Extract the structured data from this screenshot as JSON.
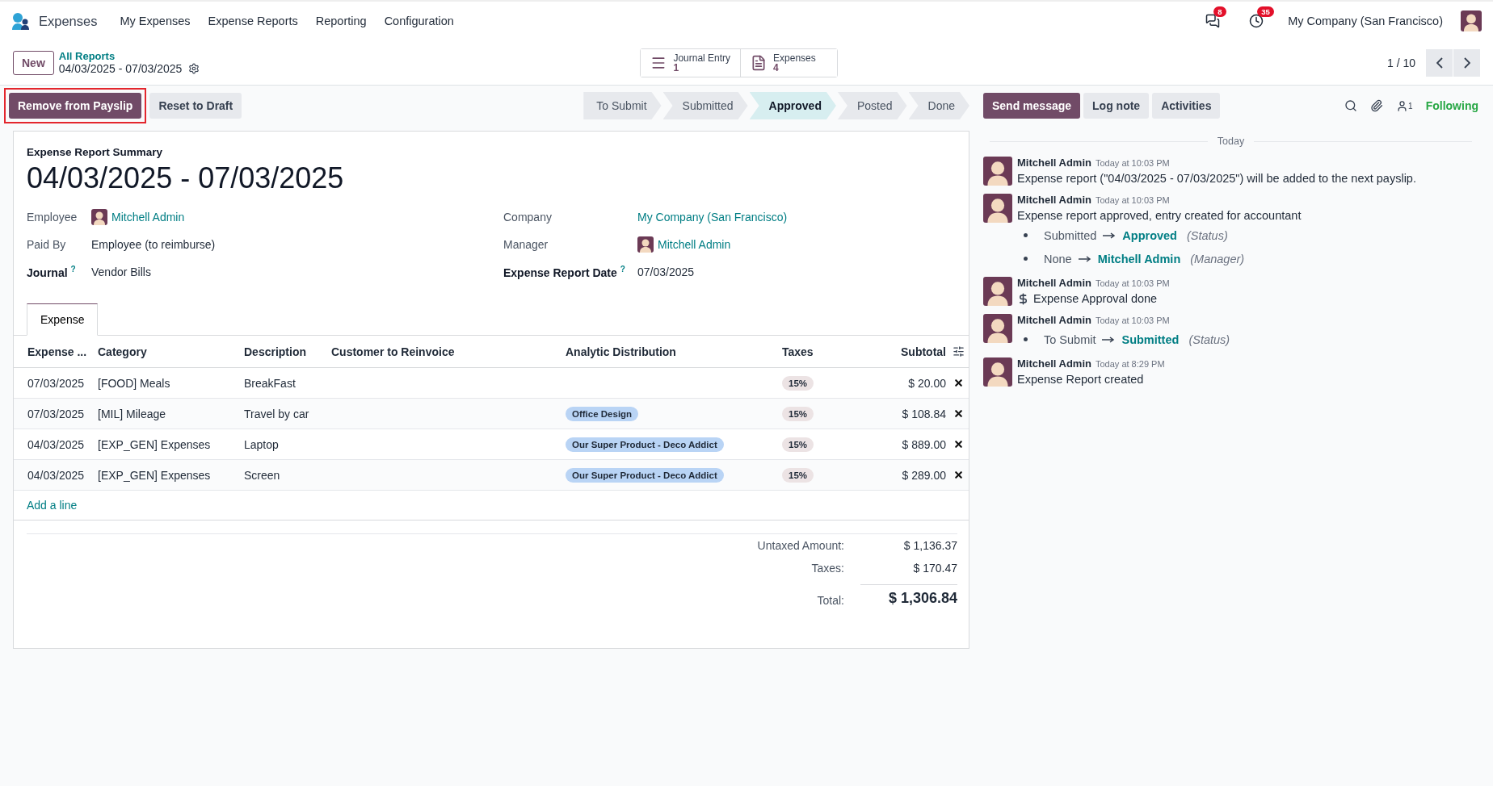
{
  "navbar": {
    "app_name": "Expenses",
    "menu": [
      "My Expenses",
      "Expense Reports",
      "Reporting",
      "Configuration"
    ],
    "messages_badge": "8",
    "activities_badge": "35",
    "company": "My Company (San Francisco)"
  },
  "control_panel": {
    "new_button": "New",
    "breadcrumb": "All Reports",
    "record_name": "04/03/2025 - 07/03/2025",
    "pager": "1 / 10",
    "smart_buttons": [
      {
        "kind": "list",
        "label": "Journal Entry",
        "count": "1"
      },
      {
        "kind": "document",
        "label": "Expenses",
        "count": "4"
      }
    ]
  },
  "actions": [
    {
      "label": "Remove from Payslip",
      "primary": true,
      "highlighted": true
    },
    {
      "label": "Reset to Draft",
      "primary": false,
      "highlighted": false
    }
  ],
  "stages": [
    {
      "label": "To Submit",
      "selected": false
    },
    {
      "label": "Submitted",
      "selected": false
    },
    {
      "label": "Approved",
      "selected": true
    },
    {
      "label": "Posted",
      "selected": false
    },
    {
      "label": "Done",
      "selected": false
    }
  ],
  "chatter_actions": [
    {
      "label": "Send message",
      "primary": true
    },
    {
      "label": "Log note",
      "primary": false
    },
    {
      "label": "Activities",
      "primary": false
    }
  ],
  "followers": {
    "count": "1",
    "label": "Following"
  },
  "form": {
    "summary_label": "Expense Report Summary",
    "title": "04/03/2025 - 07/03/2025",
    "left_fields": [
      {
        "label": "Employee",
        "value": "Mitchell Admin",
        "kind": "avatar_link",
        "required": false
      },
      {
        "label": "Paid By",
        "value": "Employee (to reimburse)",
        "kind": "text",
        "required": false
      },
      {
        "label": "Journal",
        "value": "Vendor Bills",
        "kind": "text",
        "required": true,
        "help": "?"
      }
    ],
    "right_fields": [
      {
        "label": "Company",
        "value": "My Company (San Francisco)",
        "kind": "link",
        "required": false
      },
      {
        "label": "Manager",
        "value": "Mitchell Admin",
        "kind": "avatar_link",
        "required": false
      },
      {
        "label": "Expense Report Date",
        "value": "07/03/2025",
        "kind": "text",
        "required": true,
        "help": "?"
      }
    ],
    "tabs": [
      {
        "label": "Expense",
        "selected": true
      }
    ],
    "table": {
      "columns": [
        "Expense ...",
        "Category",
        "Description",
        "Customer to Reinvoice",
        "Analytic Distribution",
        "Taxes",
        "Subtotal"
      ],
      "rows": [
        {
          "date": "07/03/2025",
          "category": "[FOOD] Meals",
          "description": "BreakFast",
          "taxes": "15%",
          "subtotal": "$ 20.00"
        },
        {
          "date": "07/03/2025",
          "category": "[MIL] Mileage",
          "description": "Travel by car",
          "analytic": "Office Design",
          "taxes": "15%",
          "subtotal": "$ 108.84"
        },
        {
          "date": "04/03/2025",
          "category": "[EXP_GEN] Expenses",
          "description": "Laptop",
          "analytic": "Our Super Product - Deco Addict",
          "taxes": "15%",
          "subtotal": "$ 889.00"
        },
        {
          "date": "04/03/2025",
          "category": "[EXP_GEN] Expenses",
          "description": "Screen",
          "analytic": "Our Super Product - Deco Addict",
          "taxes": "15%",
          "subtotal": "$ 289.00"
        }
      ]
    },
    "add_line": "Add a line",
    "totals": [
      {
        "label": "Untaxed Amount:",
        "value": "$ 1,136.37",
        "kind": "normal"
      },
      {
        "label": "Taxes:",
        "value": "$ 170.47",
        "kind": "normal"
      },
      {
        "label": "Total:",
        "value": "$ 1,306.84",
        "kind": "grand"
      }
    ]
  },
  "chatter": {
    "date_separator": "Today",
    "messages": [
      {
        "author": "Mitchell Admin",
        "time": "Today at 10:03 PM",
        "kind": "text",
        "body": "Expense report (\"04/03/2025 - 07/03/2025\") will be added to the next payslip."
      },
      {
        "author": "Mitchell Admin",
        "time": "Today at 10:03 PM",
        "kind": "tracking",
        "body": "Expense report approved, entry created for accountant",
        "changes": [
          {
            "old": "Submitted",
            "new": "Approved",
            "field": "(Status)"
          },
          {
            "old": "None",
            "new": "Mitchell Admin",
            "field": "(Manager)"
          }
        ]
      },
      {
        "author": "Mitchell Admin",
        "time": "Today at 10:03 PM",
        "kind": "activity",
        "body": "Expense Approval done"
      },
      {
        "author": "Mitchell Admin",
        "time": "Today at 10:03 PM",
        "kind": "tracking",
        "changes": [
          {
            "old": "To Submit",
            "new": "Submitted",
            "field": "(Status)"
          }
        ]
      },
      {
        "author": "Mitchell Admin",
        "time": "Today at 8:29 PM",
        "kind": "text",
        "body": "Expense Report created"
      }
    ]
  }
}
